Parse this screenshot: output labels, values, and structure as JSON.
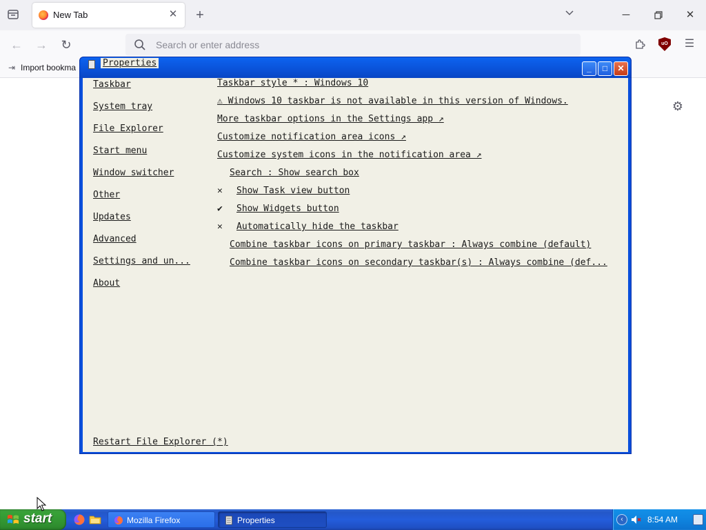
{
  "browser": {
    "tab_title": "New Tab",
    "address_placeholder": "Search or enter address",
    "bookmark_item": "Import bookma"
  },
  "properties": {
    "title": "Properties",
    "nav_items": [
      "Taskbar",
      "System tray",
      "File Explorer",
      "Start menu",
      "Window switcher",
      "Other",
      "Updates",
      "Advanced",
      "Settings and un...",
      "About"
    ],
    "options": [
      {
        "mark": "",
        "text": "Taskbar style * : Windows 10"
      },
      {
        "mark": "⚠",
        "text": "Windows 10 taskbar is not available in this version of Windows."
      },
      {
        "mark": "",
        "text": "More taskbar options in the Settings app ↗"
      },
      {
        "mark": "",
        "text": "Customize notification area icons ↗"
      },
      {
        "mark": "",
        "text": "Customize system icons in the notification area ↗"
      },
      {
        "mark": "",
        "text": "Search : Show search box"
      },
      {
        "mark": "✕",
        "text": "Show Task view button"
      },
      {
        "mark": "✔",
        "text": "Show Widgets button"
      },
      {
        "mark": "✕",
        "text": "Automatically hide the taskbar"
      },
      {
        "mark": "",
        "text": "Combine taskbar icons on primary taskbar : Always combine (default)"
      },
      {
        "mark": "",
        "text": "Combine taskbar icons on secondary taskbar(s) : Always combine (def..."
      }
    ],
    "restart_label": "Restart File Explorer (*)"
  },
  "taskbar": {
    "start_label": "start",
    "buttons": [
      "Mozilla Firefox",
      "Properties"
    ],
    "clock": "8:54 AM"
  }
}
